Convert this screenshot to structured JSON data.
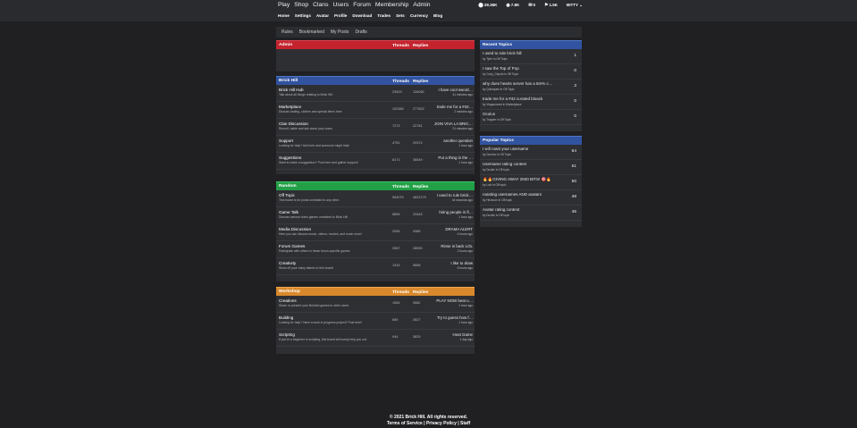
{
  "main_nav": [
    "Play",
    "Shop",
    "Clans",
    "Users",
    "Forum",
    "Membership",
    "Admin"
  ],
  "stats": [
    {
      "icon": "coin-icon",
      "glyph": "⬤",
      "value": "29.36K"
    },
    {
      "icon": "currency-icon",
      "glyph": "◉",
      "value": "7.8K"
    },
    {
      "icon": "mail-icon",
      "glyph": "✉",
      "value": "0"
    },
    {
      "icon": "notification-icon",
      "glyph": "⚑",
      "value": "1.5K"
    }
  ],
  "username": "BITTY",
  "sub_nav": [
    "Home",
    "Settings",
    "Avatar",
    "Profile",
    "Download",
    "Trades",
    "Sets",
    "Currency",
    "Blog"
  ],
  "tabs": [
    "Rules",
    "Bookmarked",
    "My Posts",
    "Drafts"
  ],
  "threads_label": "Threads",
  "replies_label": "Replies",
  "sections": {
    "admin": {
      "title": "Admin"
    },
    "brickhill": {
      "title": "Brick Hill",
      "boards": [
        {
          "name": "Brick Hill Hub",
          "desc": "Talk about all things relating to Brick Hill.",
          "threads": "23529",
          "replies": "126062",
          "last_title": "I have cool sword…",
          "last_ago": "41 minutes ago"
        },
        {
          "name": "Marketplace",
          "desc": "Discuss trading, clothes and special items here",
          "threads": "102383",
          "replies": "277822",
          "last_title": "trade me for a #42…",
          "last_ago": "2 minutes ago"
        },
        {
          "name": "Clan Discussion",
          "desc": "Recruit, battle and talk about your clans.",
          "threads": "7273",
          "replies": "22781",
          "last_title": "JOIN VIVA LA BRIC…",
          "last_ago": "21 minutes ago"
        },
        {
          "name": "Support",
          "desc": "Looking for help? Ask here and someone might help!",
          "threads": "4751",
          "replies": "29374",
          "last_title": "another question",
          "last_ago": "1 hour ago"
        },
        {
          "name": "Suggestions",
          "desc": "Want to make a suggestion? Post here and gather support!",
          "threads": "8171",
          "replies": "36549",
          "last_title": "Put a thing in the …",
          "last_ago": "1 hour ago"
        }
      ]
    },
    "random": {
      "title": "Random",
      "boards": [
        {
          "name": "Off Topic",
          "desc": "This board is for posts unrelated to any other.",
          "threads": "964075",
          "replies": "4822175",
          "last_title": "I used to rule brick…",
          "last_ago": "44 seconds ago"
        },
        {
          "name": "Game Talk",
          "desc": "Discuss various video games unrelated to Brick Hill.",
          "threads": "5855",
          "replies": "23445",
          "last_title": "hiring people in fl…",
          "last_ago": "1 hour ago"
        },
        {
          "name": "Media Discussion",
          "desc": "Here you can discuss music, videos, movies, and much more!",
          "threads": "2054",
          "replies": "9385",
          "last_title": "DRAMA ALERT",
          "last_ago": "4 hours ago"
        },
        {
          "name": "Forum Games",
          "desc": "Participate with others in these forum-specific games.",
          "threads": "3367",
          "replies": "28050",
          "last_title": "Rinse is back LOL",
          "last_ago": "2 hours ago"
        },
        {
          "name": "Creativity",
          "desc": "Show off your many talents in this board!",
          "threads": "1415",
          "replies": "5668",
          "last_title": "I like to draw",
          "last_ago": "8 hours ago"
        }
      ]
    },
    "workshop": {
      "title": "Workshop",
      "boards": [
        {
          "name": "Creations",
          "desc": "Share or present your finished games to other users.",
          "threads": "1084",
          "replies": "3682",
          "last_title": "PLAY NOW beat u…",
          "last_ago": "1 hour ago"
        },
        {
          "name": "Building",
          "desc": "Looking for help? Have a work in progress project? Post here!",
          "threads": "689",
          "replies": "2827",
          "last_title": "Try to guess how f…",
          "last_ago": "1 hour ago"
        },
        {
          "name": "Scripting",
          "desc": "If you're a beginner in scripting, this board will surely help you out.",
          "threads": "944",
          "replies": "3629",
          "last_title": "Heat Game",
          "last_ago": "1 day ago"
        }
      ]
    }
  },
  "recent_topics": {
    "title": "Recent Topics",
    "items": [
      {
        "title": "I used to rule brick hill",
        "by": "by Tyler in Off Topic",
        "count": "1"
      },
      {
        "title": "I saw the Top of Pop",
        "by": "by Cody_Cejudo in Off Topic",
        "count": "0"
      },
      {
        "title": "why does hearts server has a 5m% c…",
        "by": "by Quimquee in Off Topic",
        "count": "3"
      },
      {
        "title": "trade me for a #42 curated bloack",
        "by": "by Viagacmund in Marketplace",
        "count": "0"
      },
      {
        "title": "Oculus",
        "by": "by Trapper in Off Topic",
        "count": "0"
      }
    ]
  },
  "popular_topics": {
    "title": "Popular Topics",
    "items": [
      {
        "title": "I will roast your username",
        "by": "by Domino in Off Topic",
        "count": "64"
      },
      {
        "title": "Username rating contest",
        "by": "by Duckie in Off topic",
        "count": "51"
      },
      {
        "title": "🔥🔥GIVING AWAY 2500 BITS! 🎯🔥",
        "by": "by Lolo in Off topic",
        "count": "50"
      },
      {
        "title": "roasting usernames AND avatars",
        "by": "by Hezzoon in Off topic",
        "count": "48"
      },
      {
        "title": "Avatar rating contest",
        "by": "by Duckie in Off topic",
        "count": "46"
      }
    ]
  },
  "footer": {
    "copyright": "© 2021 Brick Hill. All rights reserved.",
    "links": "Terms of Service | Privacy Policy | Staff"
  }
}
